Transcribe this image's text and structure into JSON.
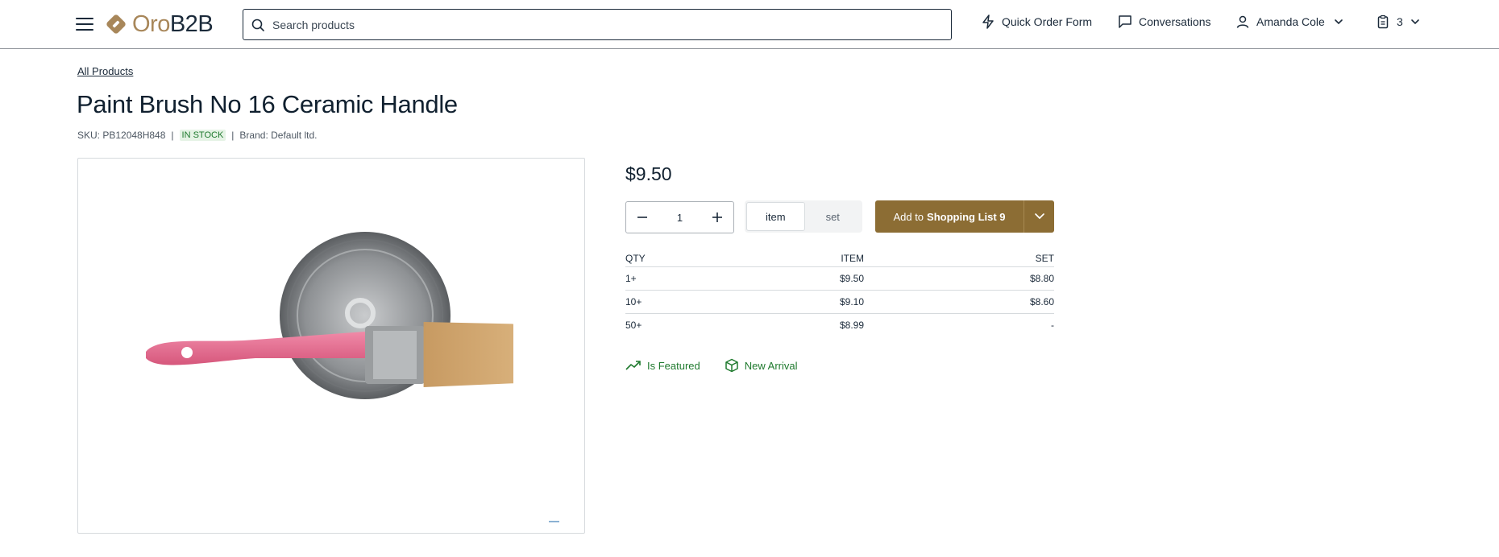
{
  "header": {
    "logo": {
      "oro": "Oro",
      "b2b": "B2B"
    },
    "search": {
      "placeholder": "Search products"
    },
    "quick_order": "Quick Order Form",
    "conversations": "Conversations",
    "user": "Amanda Cole",
    "cart_count": "3",
    "colors": {
      "brand_gold": "#a8875a",
      "text": "#1b2a3a"
    }
  },
  "breadcrumb": "All Products",
  "product": {
    "title": "Paint Brush No 16 Ceramic Handle",
    "sku": "SKU: PB12048H848",
    "stock": "IN STOCK",
    "brand": "Brand: Default ltd.",
    "price": "$9.50",
    "image_icon": "paint-brush-with-can-image"
  },
  "purchase": {
    "quantity": "1",
    "units": [
      "item",
      "set"
    ],
    "selected_unit": "item",
    "add_prefix": "Add to",
    "add_list": "Shopping List 9",
    "button_color": "#8c6d34"
  },
  "price_table": {
    "headers": [
      "QTY",
      "ITEM",
      "SET"
    ],
    "rows": [
      [
        "1+",
        "$9.50",
        "$8.80"
      ],
      [
        "10+",
        "$9.10",
        "$8.60"
      ],
      [
        "50+",
        "$8.99",
        "-"
      ]
    ]
  },
  "tags": [
    "Is Featured",
    "New Arrival"
  ]
}
